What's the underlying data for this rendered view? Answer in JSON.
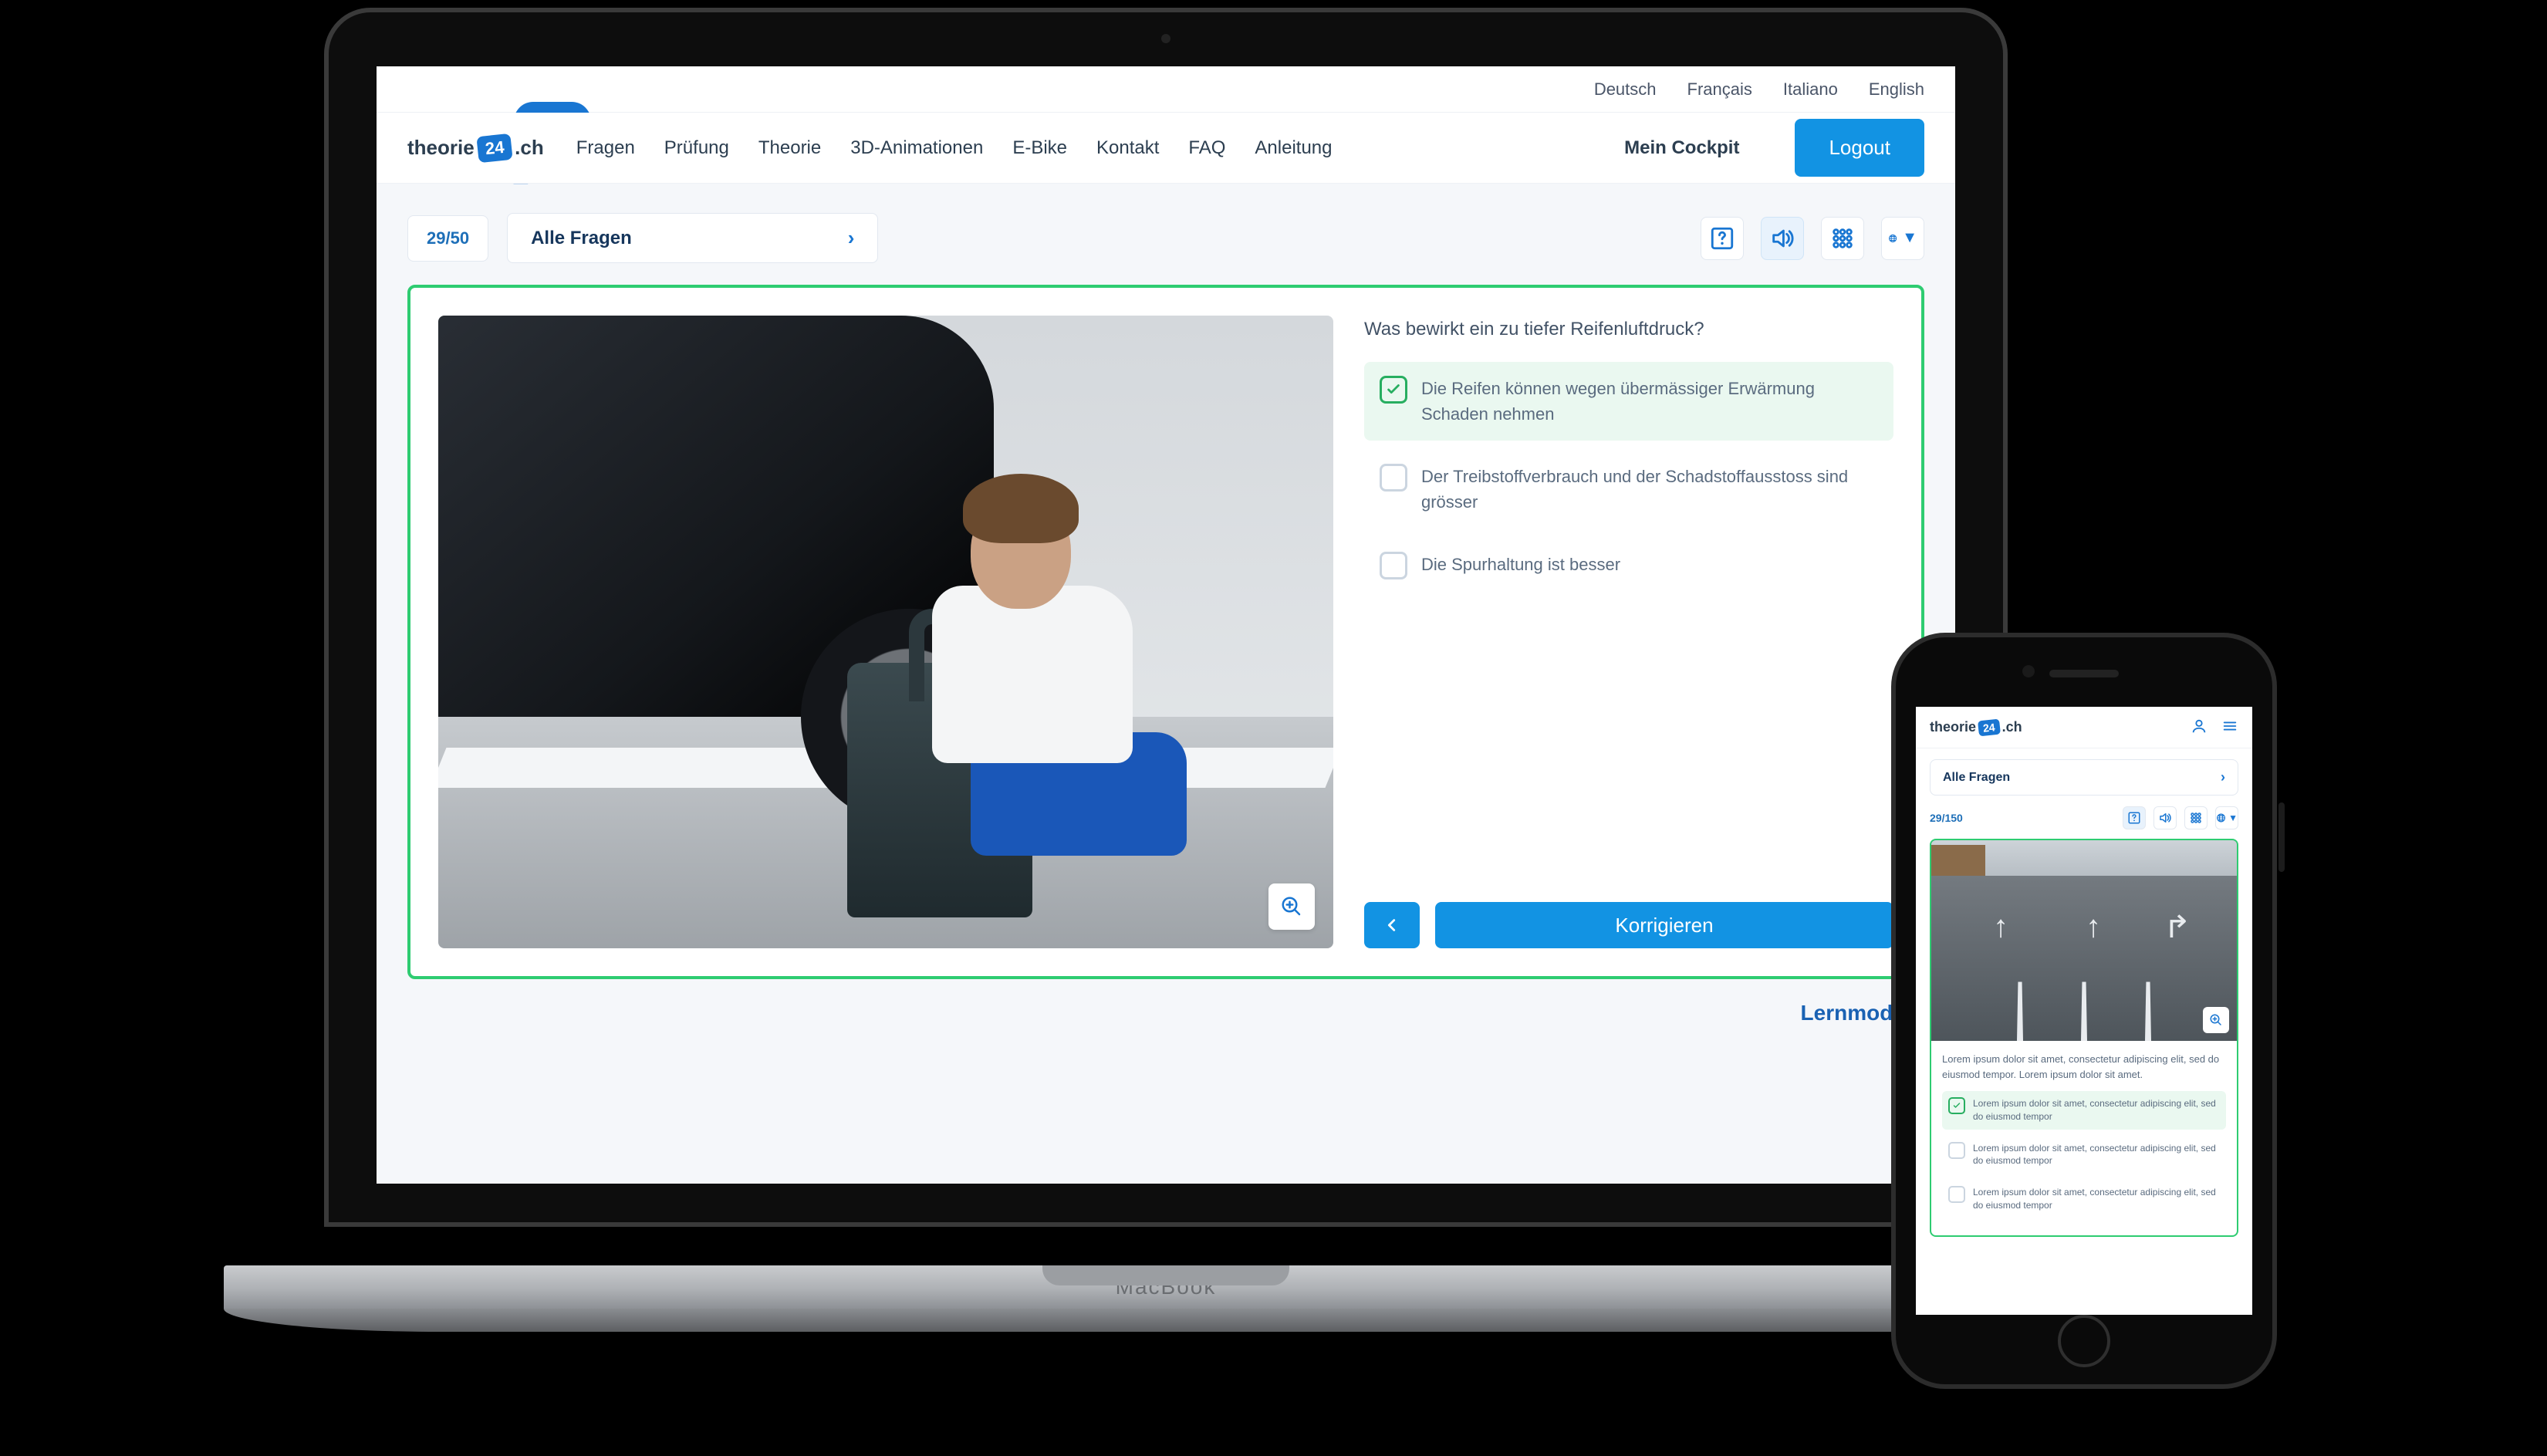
{
  "brand": {
    "prefix": "theorie",
    "badge": "24",
    "suffix": ".ch"
  },
  "topbar": {
    "languages": [
      "Deutsch",
      "Français",
      "Italiano",
      "English"
    ]
  },
  "nav": {
    "items": [
      "Fragen",
      "Prüfung",
      "Theorie",
      "3D-Animationen",
      "E-Bike",
      "Kontakt",
      "FAQ",
      "Anleitung"
    ],
    "cockpit": "Mein Cockpit",
    "logout": "Logout"
  },
  "toolbar": {
    "counter": "29/50",
    "filter": "Alle Fragen"
  },
  "question": {
    "text": "Was bewirkt ein zu tiefer Reifenluftdruck?",
    "answers": [
      {
        "text": "Die Reifen können wegen übermässiger Erwärmung Schaden nehmen",
        "checked": true,
        "correct": true
      },
      {
        "text": "Der Treibstoffverbrauch und der Schadstoffausstoss sind grösser",
        "checked": false,
        "correct": false
      },
      {
        "text": "Die Spurhaltung ist besser",
        "checked": false,
        "correct": false
      }
    ],
    "submit": "Korrigieren"
  },
  "mode_label": "Lernmodus",
  "mobile": {
    "filter": "Alle Fragen",
    "counter": "29/150",
    "question": "Lorem ipsum dolor sit amet, consectetur adipiscing elit, sed do eiusmod tempor. Lorem ipsum dolor sit amet.",
    "answers": [
      {
        "text": "Lorem ipsum dolor sit amet, consectetur adipiscing elit, sed do eiusmod tempor",
        "checked": true,
        "correct": true
      },
      {
        "text": "Lorem ipsum dolor sit amet, consectetur adipiscing elit, sed do eiusmod tempor",
        "checked": false,
        "correct": false
      },
      {
        "text": "Lorem ipsum dolor sit amet, consectetur adipiscing elit, sed do eiusmod tempor",
        "checked": false,
        "correct": false
      }
    ]
  },
  "macbook_label": "MacBook"
}
